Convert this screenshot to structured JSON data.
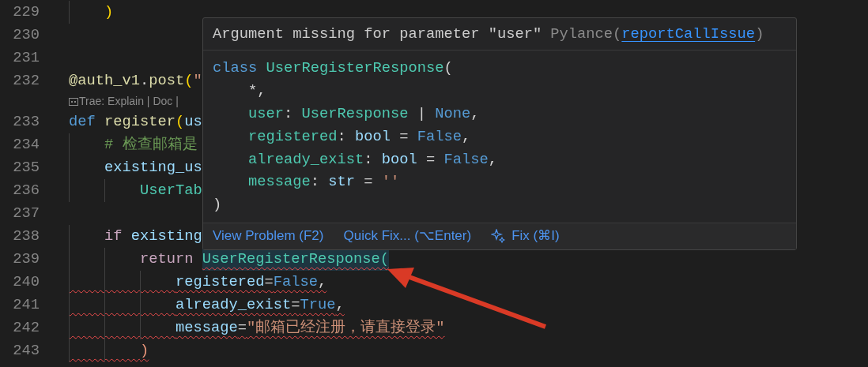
{
  "editor": {
    "lines": [
      {
        "kind": "code",
        "number": "229",
        "error": false,
        "tokens": [
          {
            "text": "    )",
            "kind": "bracket"
          }
        ]
      },
      {
        "kind": "code",
        "number": "230",
        "error": false
      },
      {
        "kind": "code",
        "number": "231",
        "error": false
      },
      {
        "kind": "code",
        "number": "232",
        "error": false,
        "tokens": [
          {
            "text": "@auth_v1",
            "kind": "function"
          },
          {
            "text": ".",
            "kind": "punct"
          },
          {
            "text": "post",
            "kind": "function"
          },
          {
            "text": "(",
            "kind": "bracket"
          },
          {
            "text": "\"",
            "kind": "string"
          }
        ]
      },
      {
        "kind": "codelens",
        "text": "Trae: Explain | Doc |"
      },
      {
        "kind": "code",
        "number": "233",
        "error": false,
        "tokens": [
          {
            "text": "def ",
            "kind": "keyword"
          },
          {
            "text": "register",
            "kind": "function"
          },
          {
            "text": "(",
            "kind": "bracket"
          },
          {
            "text": "us",
            "kind": "variable"
          }
        ]
      },
      {
        "kind": "code",
        "number": "234",
        "error": false,
        "tokens": [
          {
            "text": "    # 检查邮箱是",
            "kind": "comment"
          }
        ]
      },
      {
        "kind": "code",
        "number": "235",
        "error": false,
        "tokens": [
          {
            "text": "    existing_us",
            "kind": "variable"
          }
        ]
      },
      {
        "kind": "code",
        "number": "236",
        "error": false,
        "tokens": [
          {
            "text": "        UserTab",
            "kind": "class"
          }
        ]
      },
      {
        "kind": "code",
        "number": "237",
        "error": false
      },
      {
        "kind": "code",
        "number": "238",
        "error": false,
        "tokens": [
          {
            "text": "    if ",
            "kind": "control"
          },
          {
            "text": "existing",
            "kind": "variable"
          }
        ]
      },
      {
        "kind": "code",
        "number": "239",
        "error": false,
        "tokens": [
          {
            "text": "        return ",
            "kind": "control"
          },
          {
            "text": "UserRegisterResponse(",
            "kind": "class",
            "error": true
          }
        ]
      },
      {
        "kind": "code",
        "number": "240",
        "error": true,
        "tokens": [
          {
            "text": "            registered",
            "kind": "variable"
          },
          {
            "text": "=",
            "kind": "punct"
          },
          {
            "text": "False",
            "kind": "keyword"
          },
          {
            "text": ",",
            "kind": "punct"
          }
        ]
      },
      {
        "kind": "code",
        "number": "241",
        "error": true,
        "tokens": [
          {
            "text": "            already_exist",
            "kind": "variable"
          },
          {
            "text": "=",
            "kind": "punct"
          },
          {
            "text": "True",
            "kind": "keyword"
          },
          {
            "text": ",",
            "kind": "punct"
          }
        ]
      },
      {
        "kind": "code",
        "number": "242",
        "error": true,
        "tokens": [
          {
            "text": "            message",
            "kind": "variable"
          },
          {
            "text": "=",
            "kind": "punct"
          },
          {
            "text": "\"邮箱已经注册，请直接登录\"",
            "kind": "string"
          }
        ]
      },
      {
        "kind": "code",
        "number": "243",
        "error": true,
        "tokens": [
          {
            "text": "        )",
            "kind": "bracket2"
          }
        ]
      }
    ]
  },
  "hover": {
    "message": "Argument missing for parameter \"user\"",
    "source": "Pylance(",
    "rule": "reportCallIssue",
    "source_end": ")",
    "code": [
      [
        {
          "text": "class ",
          "kind": "keyword"
        },
        {
          "text": "UserRegisterResponse",
          "kind": "class"
        },
        {
          "text": "(",
          "kind": "punct"
        }
      ],
      [
        {
          "text": "    *,",
          "kind": "punct"
        }
      ],
      [
        {
          "text": "    user",
          "kind": "class"
        },
        {
          "text": ": ",
          "kind": "punct"
        },
        {
          "text": "UserResponse",
          "kind": "class"
        },
        {
          "text": " | ",
          "kind": "punct"
        },
        {
          "text": "None",
          "kind": "keyword"
        },
        {
          "text": ",",
          "kind": "punct"
        }
      ],
      [
        {
          "text": "    registered",
          "kind": "class"
        },
        {
          "text": ": ",
          "kind": "punct"
        },
        {
          "text": "bool",
          "kind": "variable"
        },
        {
          "text": " = ",
          "kind": "punct"
        },
        {
          "text": "False",
          "kind": "keyword"
        },
        {
          "text": ",",
          "kind": "punct"
        }
      ],
      [
        {
          "text": "    already_exist",
          "kind": "class"
        },
        {
          "text": ": ",
          "kind": "punct"
        },
        {
          "text": "bool",
          "kind": "variable"
        },
        {
          "text": " = ",
          "kind": "punct"
        },
        {
          "text": "False",
          "kind": "keyword"
        },
        {
          "text": ",",
          "kind": "punct"
        }
      ],
      [
        {
          "text": "    message",
          "kind": "class"
        },
        {
          "text": ": ",
          "kind": "punct"
        },
        {
          "text": "str",
          "kind": "variable"
        },
        {
          "text": " = ",
          "kind": "punct"
        },
        {
          "text": "''",
          "kind": "string"
        }
      ],
      [
        {
          "text": ")",
          "kind": "punct"
        }
      ]
    ],
    "actions": [
      {
        "label": "View Problem (F2)",
        "kind": "plain"
      },
      {
        "label": "Quick Fix... (⌥Enter)",
        "kind": "plain"
      },
      {
        "label": "Fix (⌘I)",
        "kind": "ai"
      }
    ]
  }
}
